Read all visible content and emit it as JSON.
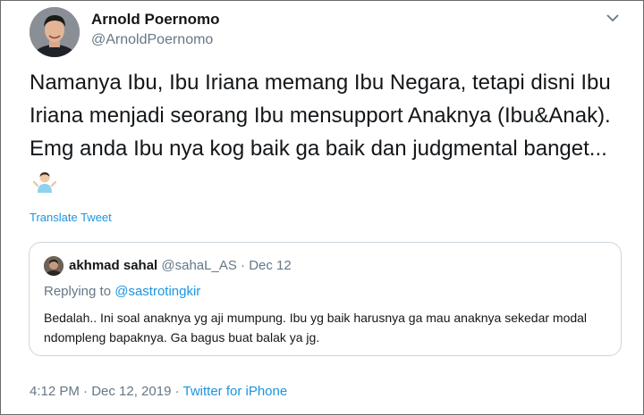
{
  "author": {
    "name": "Arnold Poernomo",
    "handle": "@ArnoldPoernomo"
  },
  "tweet": {
    "text": "Namanya Ibu, Ibu Iriana memang Ibu Negara, tetapi disni Ibu Iriana menjadi seorang Ibu mensupport Anaknya (Ibu&Anak). Emg anda Ibu nya kog baik ga baik dan judgmental banget...",
    "emoji_icon": "person-shrugging-icon",
    "translate_label": "Translate Tweet"
  },
  "quote": {
    "name": "akhmad sahal",
    "handle": "@sahaL_AS",
    "separator": "·",
    "date": "Dec 12",
    "replying_prefix": "Replying to ",
    "replying_to": "@sastrotingkir",
    "text": "Bedalah.. Ini soal anaknya yg aji mumpung. Ibu yg baik harusnya  ga mau anaknya sekedar modal ndompleng bapaknya. Ga bagus buat balak ya jg."
  },
  "meta": {
    "timestamp": "4:12 PM · Dec 12, 2019 · ",
    "source": "Twitter for iPhone"
  },
  "icons": {
    "more": "chevron-down-icon",
    "avatar": "profile-photo",
    "quote_avatar": "profile-photo"
  },
  "colors": {
    "link": "#1b95e0",
    "secondary_text": "#657786",
    "primary_text": "#14171a",
    "border": "#ccd6dd"
  }
}
